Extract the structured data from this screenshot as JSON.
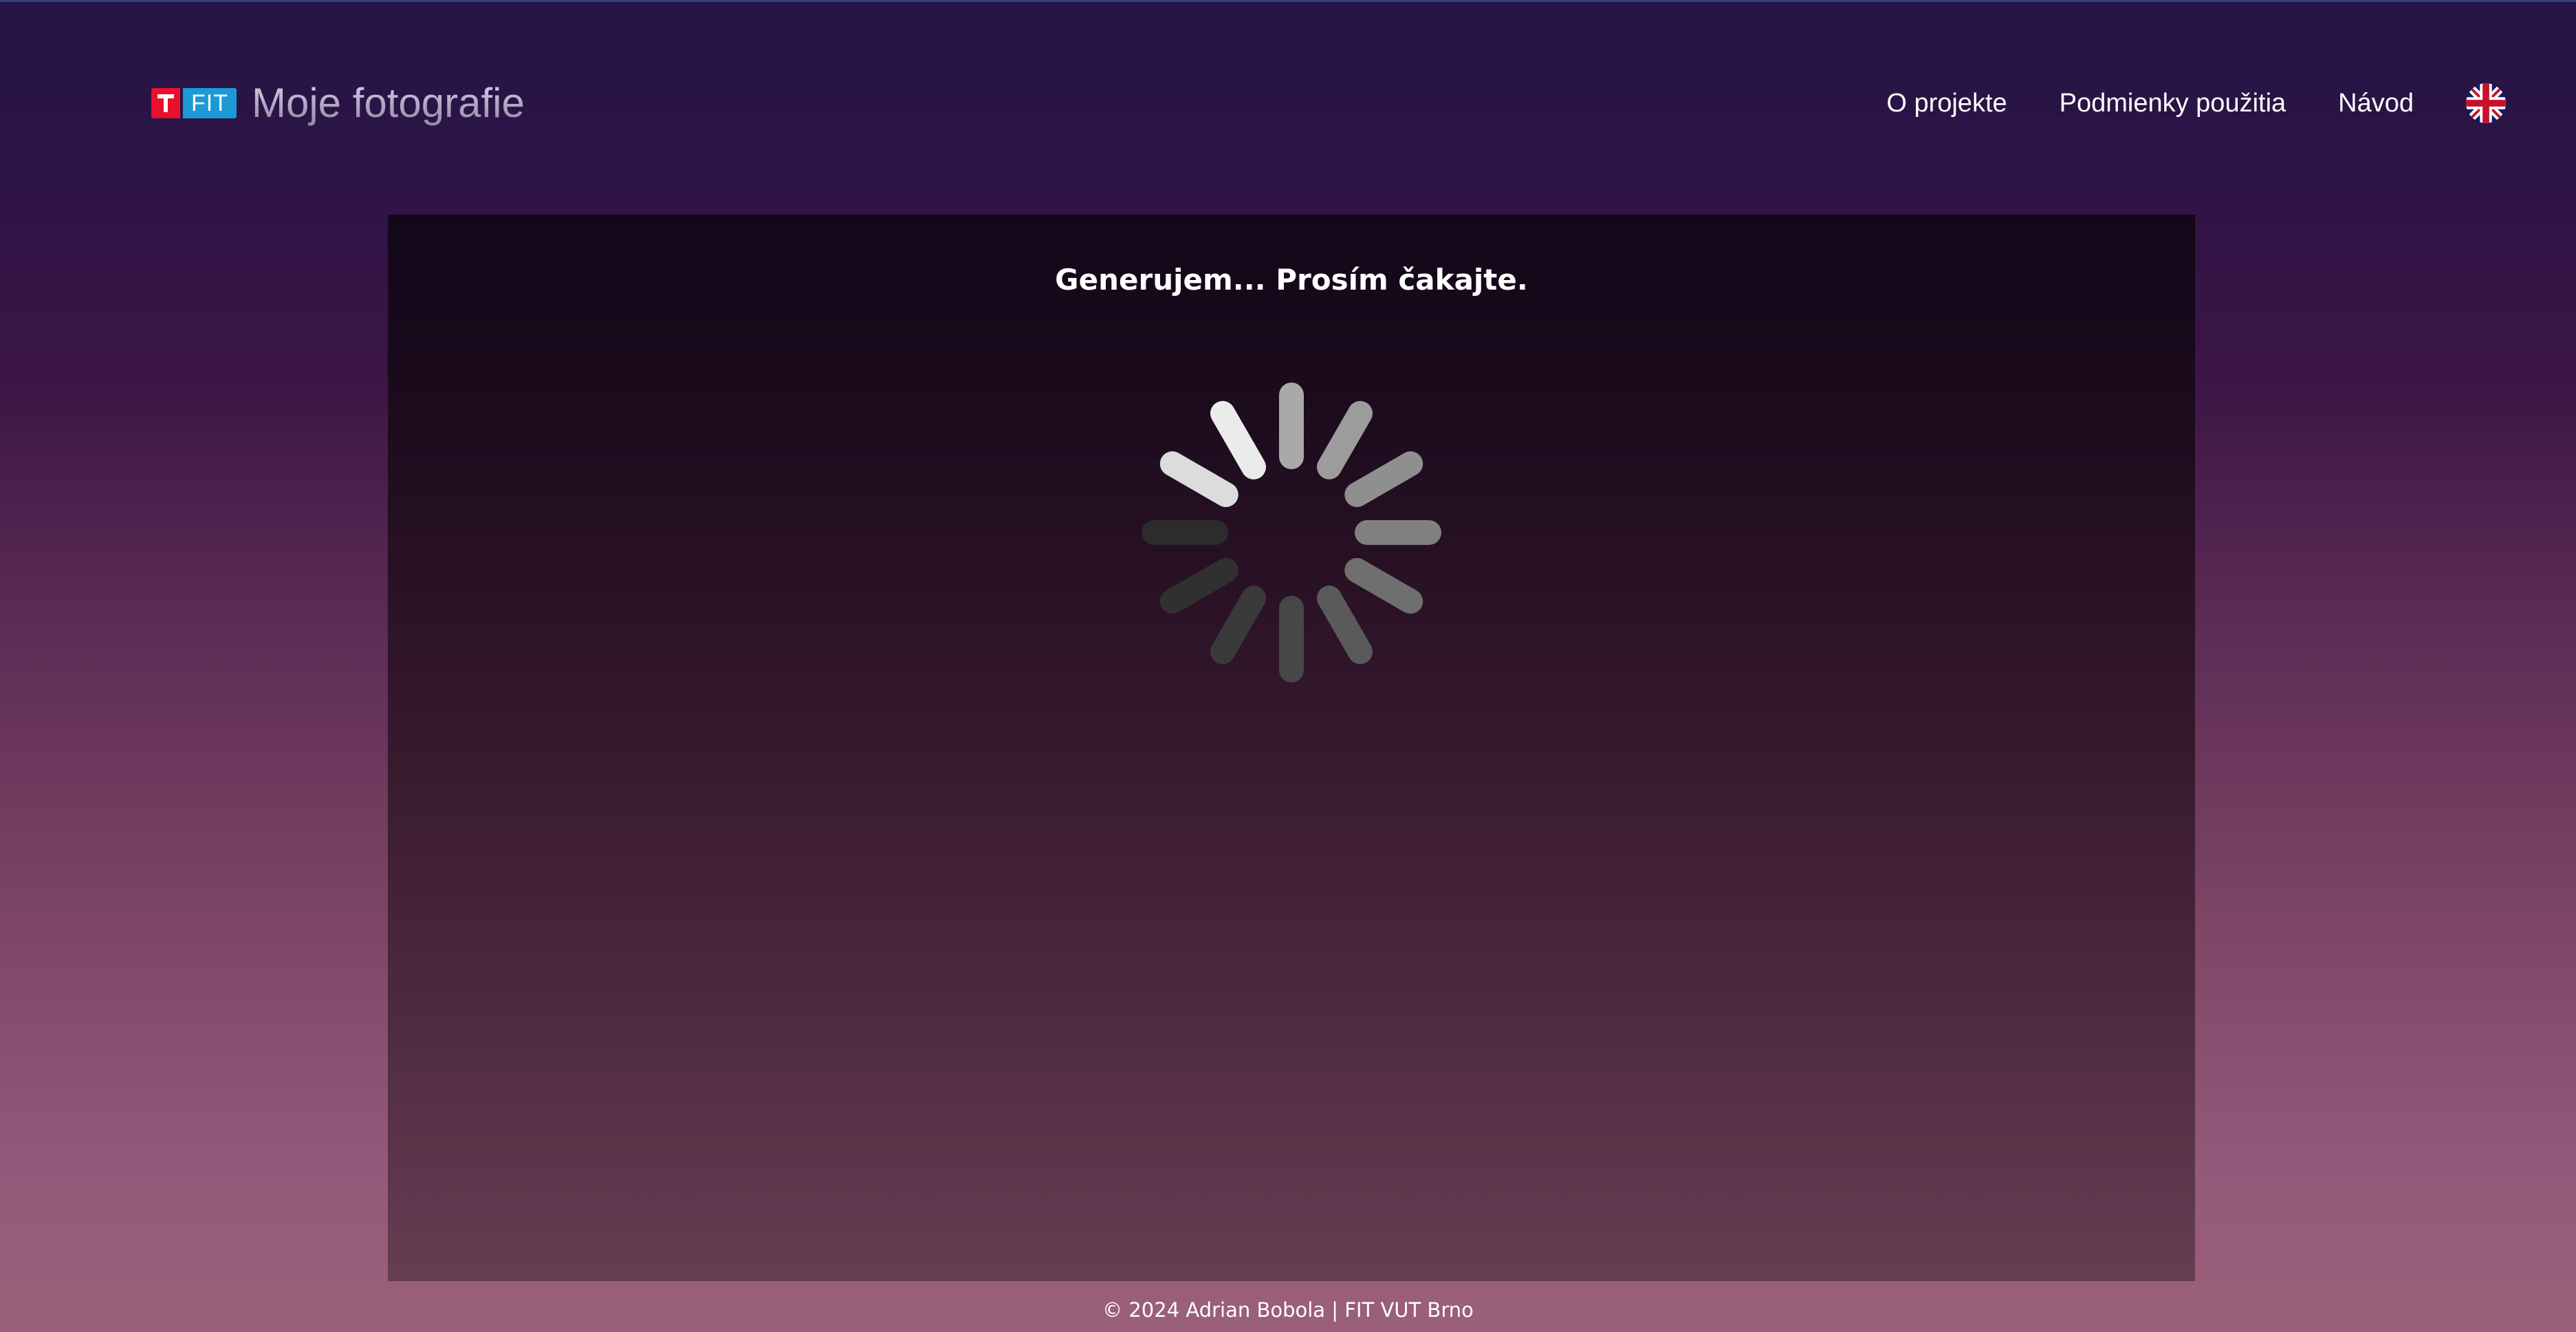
{
  "header": {
    "logo_text": "FIT",
    "title": "Moje fotografie"
  },
  "nav": {
    "items": [
      {
        "label": "O projekte"
      },
      {
        "label": "Podmienky použitia"
      },
      {
        "label": "Návod"
      }
    ],
    "language_icon": "uk-flag-icon"
  },
  "main": {
    "status_text": "Generujem... Prosím čakajte.",
    "spinner_icon": "loading-spinner-icon"
  },
  "footer": {
    "text": "© 2024 Adrian Bobola | FIT VUT Brno"
  },
  "colors": {
    "logo_red": "#e8102b",
    "logo_blue": "#1c9ad6",
    "background_top": "#241546",
    "background_bottom": "#9b6079"
  }
}
